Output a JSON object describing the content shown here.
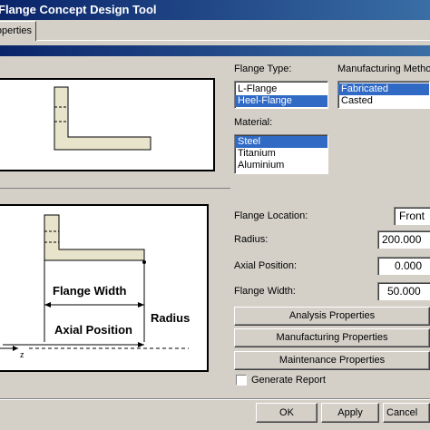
{
  "window": {
    "title": "Flange Concept Design Tool"
  },
  "tabs": [
    {
      "label": "operties"
    }
  ],
  "flange_type": {
    "label": "Flange Type:",
    "options": [
      "L-Flange",
      "Heel-Flange"
    ],
    "selected": "Heel-Flange"
  },
  "manufacturing": {
    "label": "Manufacturing Metho",
    "options": [
      "Fabricated",
      "Casted"
    ],
    "selected": "Fabricated"
  },
  "material": {
    "label": "Material:",
    "options": [
      "Steel",
      "Titanium",
      "Aluminium"
    ],
    "selected": "Steel"
  },
  "diagram": {
    "flange_width_label": "Flange Width",
    "axial_position_label": "Axial Position",
    "radius_label": "Radius",
    "axis_label": "z"
  },
  "location": {
    "label": "Flange Location:",
    "value": "Front"
  },
  "radius": {
    "label": "Radius:",
    "value": "200.000"
  },
  "axial_position": {
    "label": "Axial Position:",
    "value": "0.000"
  },
  "flange_width": {
    "label": "Flange Width:",
    "value": "50.000"
  },
  "buttons": {
    "analysis": "Analysis Properties",
    "manufacturing": "Manufacturing Properties",
    "maintenance": "Maintenance Properties",
    "ok": "OK",
    "apply": "Apply",
    "cancel": "Cancel"
  },
  "generate_report": {
    "label": "Generate Report",
    "checked": false
  },
  "colors": {
    "title_bar": "#0a246a",
    "selection": "#316ac5",
    "flange_fill": "#e8e4cc"
  }
}
